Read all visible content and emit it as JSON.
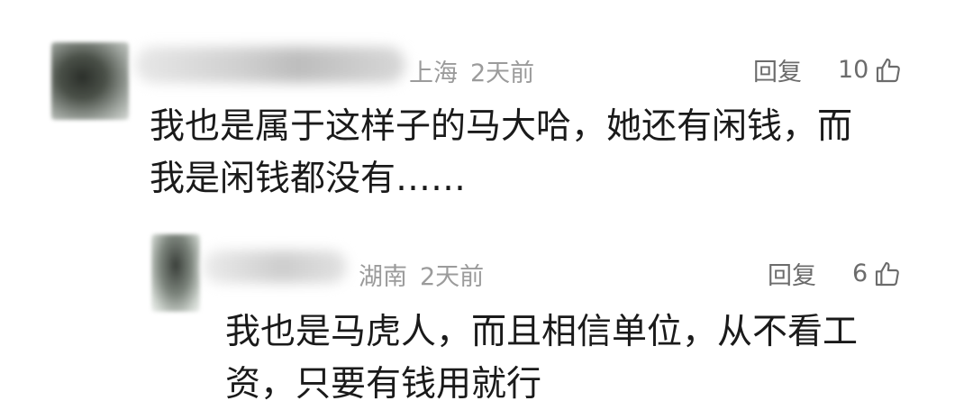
{
  "comments": [
    {
      "location": "上海",
      "time": "2天前",
      "reply_label": "回复",
      "likes": "10",
      "lines": [
        "我也是属于这样子的马大哈，她还有闲钱，而",
        "我是闲钱都没有……"
      ]
    },
    {
      "location": "湖南",
      "time": "2天前",
      "reply_label": "回复",
      "likes": "6",
      "lines": [
        "我也是马虎人，而且相信单位，从不看工",
        "资，只要有钱用就行"
      ]
    }
  ]
}
